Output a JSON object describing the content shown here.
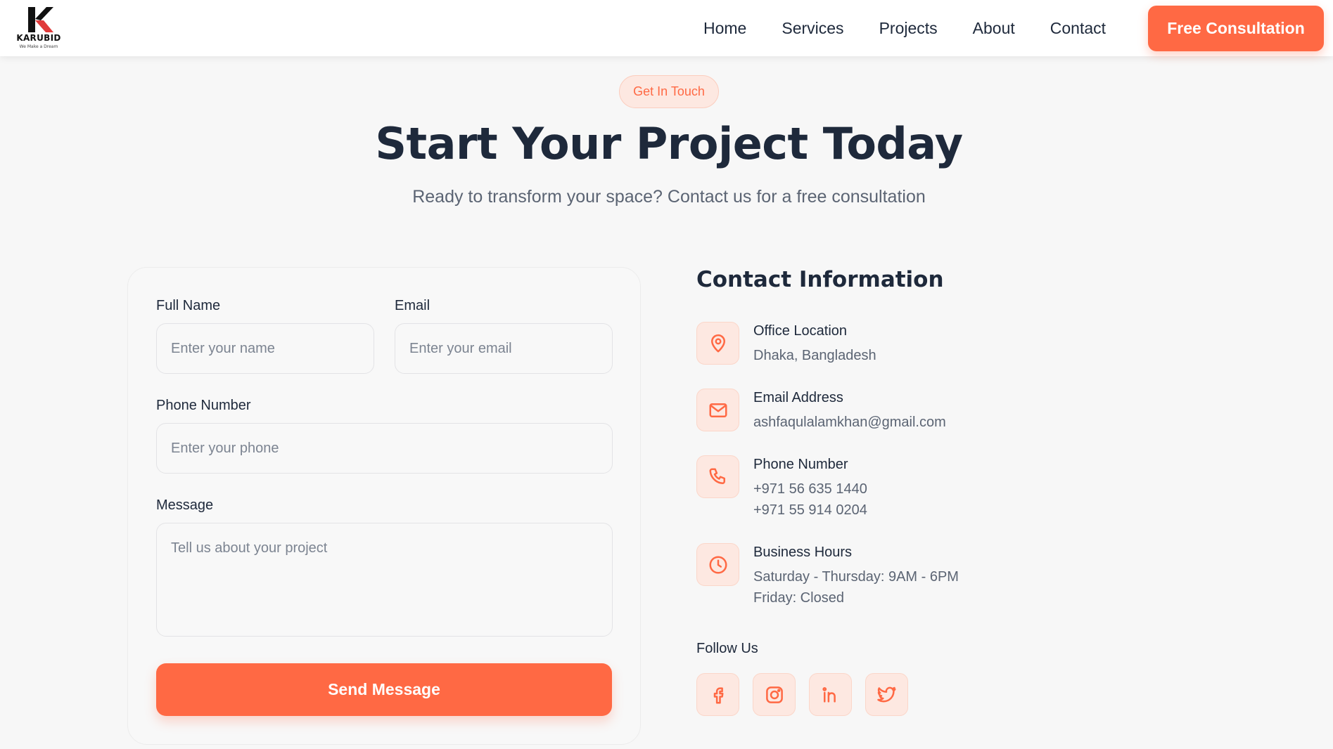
{
  "brand": {
    "name": "KARUBID",
    "tagline": "We Make a Dream",
    "colors": {
      "accent": "#ff6944",
      "accent_soft": "#fde8e1",
      "text": "#1e293b",
      "muted": "#5b6473"
    }
  },
  "nav": {
    "links": [
      "Home",
      "Services",
      "Projects",
      "About",
      "Contact"
    ],
    "cta": "Free Consultation"
  },
  "hero": {
    "badge": "Get In Touch",
    "title": "Start Your Project Today",
    "subtitle": "Ready to transform your space? Contact us for a free consultation"
  },
  "form": {
    "full_name": {
      "label": "Full Name",
      "placeholder": "Enter your name",
      "value": ""
    },
    "email": {
      "label": "Email",
      "placeholder": "Enter your email",
      "value": ""
    },
    "phone": {
      "label": "Phone Number",
      "placeholder": "Enter your phone",
      "value": ""
    },
    "message": {
      "label": "Message",
      "placeholder": "Tell us about your project",
      "value": ""
    },
    "submit": "Send Message"
  },
  "contact": {
    "title": "Contact Information",
    "items": [
      {
        "icon": "map-pin-icon",
        "heading": "Office Location",
        "lines": [
          "Dhaka, Bangladesh"
        ]
      },
      {
        "icon": "mail-icon",
        "heading": "Email Address",
        "lines": [
          "ashfaqulalamkhan@gmail.com"
        ]
      },
      {
        "icon": "phone-icon",
        "heading": "Phone Number",
        "lines": [
          "+971 56 635 1440",
          "+971 55 914 0204"
        ]
      },
      {
        "icon": "clock-icon",
        "heading": "Business Hours",
        "lines": [
          "Saturday - Thursday: 9AM - 6PM",
          "Friday: Closed"
        ]
      }
    ],
    "follow_label": "Follow Us",
    "socials": [
      "facebook-icon",
      "instagram-icon",
      "linkedin-icon",
      "twitter-icon"
    ]
  }
}
